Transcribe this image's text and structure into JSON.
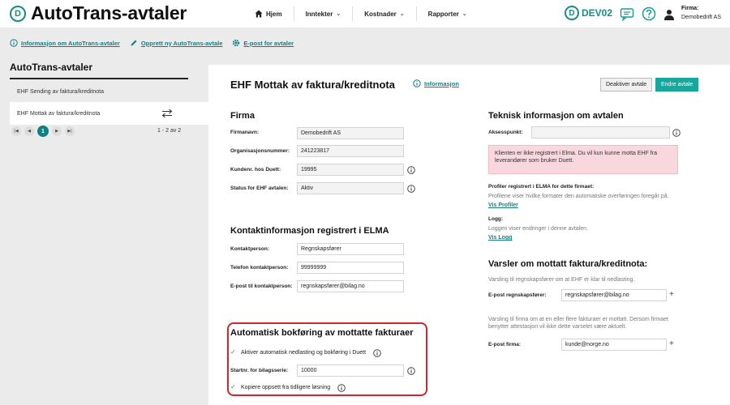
{
  "header": {
    "app_title": "AutoTrans-avtaler",
    "logo_letter": "D",
    "nav": [
      {
        "label": "Hjem"
      },
      {
        "label": "Inntekter"
      },
      {
        "label": "Kostnader"
      },
      {
        "label": "Rapporter"
      }
    ],
    "env_label": "DEV02",
    "env_letter": "D",
    "firm_label": "Firma:",
    "firm_name": "Demobedrift AS"
  },
  "links": [
    {
      "label": "Informasjon om AutoTrans-avtaler"
    },
    {
      "label": "Opprett ny AutoTrans-avtale"
    },
    {
      "label": "E-post for avtaler"
    }
  ],
  "left": {
    "title": "AutoTrans-avtaler",
    "items": [
      "EHF Sending av faktura/kreditnota",
      "EHF Mottak av faktura/kreditnota"
    ],
    "pager": {
      "first": "|◀",
      "prev": "◀",
      "current": "1",
      "next": "▶",
      "last": "▶|",
      "info": "1 - 2 av 2"
    }
  },
  "main": {
    "title": "EHF Mottak av faktura/kreditnota",
    "info_link": "Informasjon",
    "deactivate_label": "Deaktiver avtale",
    "edit_label": "Endre avtale",
    "firma": {
      "heading": "Firma",
      "fields": [
        {
          "label": "Firmanavn:",
          "value": "Demobedrift AS"
        },
        {
          "label": "Organisasjonsnummer:",
          "value": "241223817"
        },
        {
          "label": "Kundenr. hos Duett:",
          "value": "19995"
        },
        {
          "label": "Status for EHF avtalen:",
          "value": "Aktiv"
        }
      ]
    },
    "kontakt": {
      "heading": "Kontaktinformasjon registrert i ELMA",
      "fields": [
        {
          "label": "Kontaktperson:",
          "value": "Regnskapsfører"
        },
        {
          "label": "Telefon kontaktperson:",
          "value": "99999999"
        },
        {
          "label": "E-post til kontaktperson:",
          "value": "regnskapsfører@bilag.no"
        }
      ]
    },
    "auto": {
      "heading": "Automatisk bokføring av mottatte fakturaer",
      "check1": "Aktiver automatisk nedlasting og bokføring i Duett",
      "serie_label": "Startnr. for bilagsserie:",
      "serie_value": "10000",
      "check2": "Kopiere oppsett fra tidligere løsning"
    },
    "teknisk": {
      "heading": "Teknisk informasjon om avtalen",
      "aksess_label": "Aksesspunkt:",
      "aksess_value": "",
      "alert": "Klienten er ikke registrert i Elma. Du vil kun kunne motta EHF fra leverandører som bruker Duett.",
      "profiler_label": "Profiler registrert i ELMA for dette firmaet:",
      "profiler_text": "Profilene viser hvilke formater den automatiske overføringen foregår på.",
      "profiler_link": "Vis Profiler",
      "logg_label": "Logg:",
      "logg_text": "Loggen viser endringer i denne avtalen.",
      "logg_link": "Vis Logg"
    },
    "varsler": {
      "heading": "Varsler om mottatt faktura/kreditnota:",
      "text1": "Varsling til regnskapsfører om at EHF er klar til nedlasting.",
      "epost_regn_label": "E-post regnskapsfører:",
      "epost_regn_value": "regnskapsfører@bilag.no",
      "text2": "Varsling til firma om at en eller flere fakturaer er mottatt. Dersom firmaet benytter attestasjon vil ikke dette varselet være aktuelt.",
      "epost_firma_label": "E-post firma:",
      "epost_firma_value": "kunde@norge.no"
    }
  },
  "colors": {
    "accent": "#127f82",
    "button": "#18a79c",
    "alert_bg": "#f8d8de",
    "highlight": "#d0262f"
  }
}
